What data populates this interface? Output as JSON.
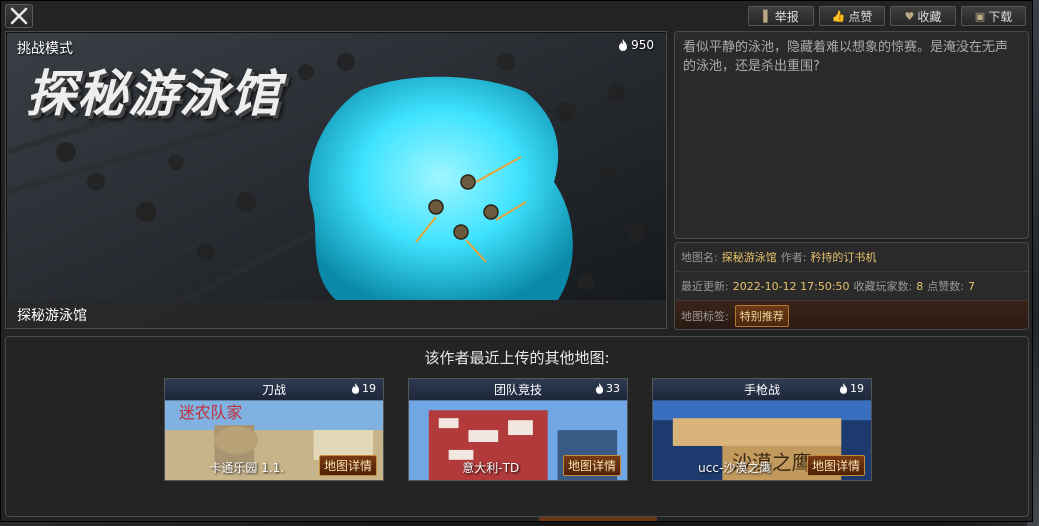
{
  "top_actions": [
    {
      "icon": "flag-icon",
      "label": "举报"
    },
    {
      "icon": "thumbs-up-icon",
      "label": "点赞"
    },
    {
      "icon": "heart-icon",
      "label": "收藏"
    },
    {
      "icon": "download-icon",
      "label": "下载"
    }
  ],
  "cover": {
    "mode": "挑战模式",
    "title_art": "探秘游泳馆",
    "heat": "950",
    "footer_name": "探秘游泳馆"
  },
  "description": "看似平静的泳池，隐藏着难以想象的惊赛。是淹没在无声的泳池，还是杀出重围?",
  "info": {
    "map_name_label": "地图名:",
    "map_name": "探秘游泳馆",
    "author_label": "作者:",
    "author": "矜持的订书机",
    "updated_label": "最近更新:",
    "updated": "2022-10-12 17:50:50",
    "favs_label": "收藏玩家数:",
    "favs": "8",
    "likes_label": "点赞数:",
    "likes": "7",
    "tags_label": "地图标签:",
    "tag": "特别推荐"
  },
  "other_maps": {
    "title": "该作者最近上传的其他地图:",
    "cards": [
      {
        "category": "刀战",
        "heat": "19",
        "name": "卡通乐园 1.1.",
        "detail": "地图详情",
        "thumb_text": "迷农队家"
      },
      {
        "category": "团队竞技",
        "heat": "33",
        "name": "意大利-TD",
        "detail": "地图详情"
      },
      {
        "category": "手枪战",
        "heat": "19",
        "name": "ucc-沙漠之鹰",
        "detail": "地图详情",
        "thumb_text": "沙漠之鹰"
      }
    ]
  },
  "colors": {
    "accent_gold": "#e7c26c",
    "pool_cyan": "#3fe3ff",
    "detail_btn": "#7a3a12"
  }
}
